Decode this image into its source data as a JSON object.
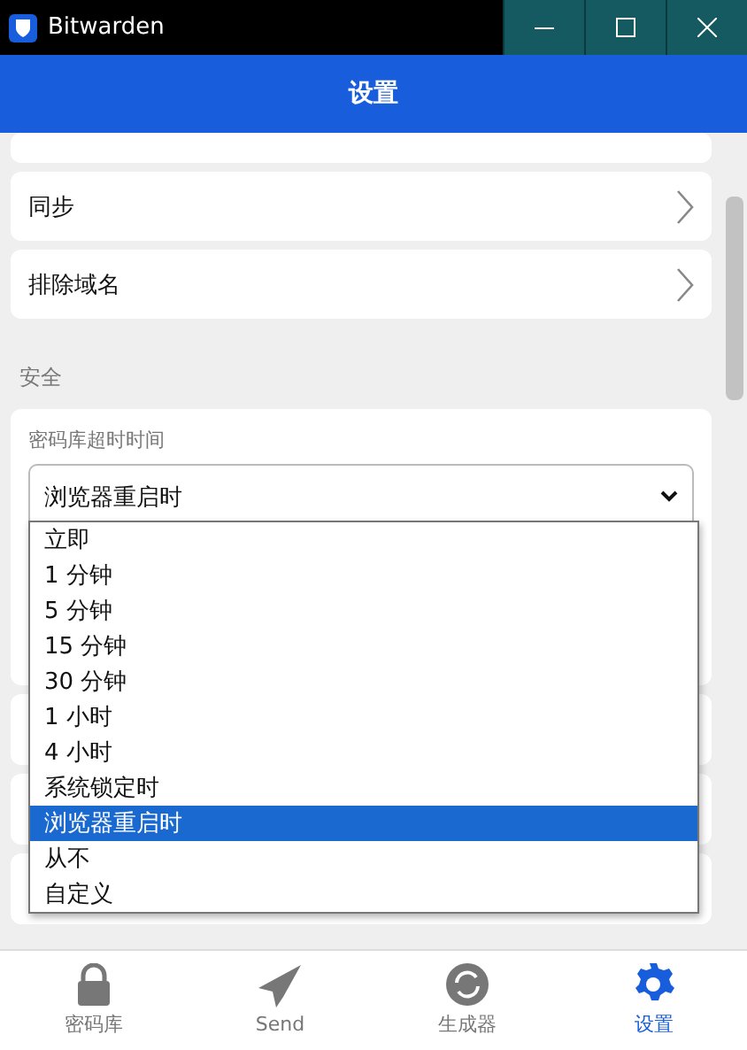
{
  "window": {
    "title": "Bitwarden",
    "controls": [
      {
        "kind": "minimize"
      },
      {
        "kind": "maximize"
      },
      {
        "kind": "close"
      }
    ]
  },
  "header": {
    "title": "设置"
  },
  "menu_items": [
    {
      "label": "同步"
    },
    {
      "label": "排除域名"
    }
  ],
  "security": {
    "heading": "安全",
    "vault_timeout": {
      "label": "密码库超时时间",
      "value": "浏览器重启时",
      "options": [
        {
          "label": "立即",
          "selected": false
        },
        {
          "label": "1 分钟",
          "selected": false
        },
        {
          "label": "5 分钟",
          "selected": false
        },
        {
          "label": "15 分钟",
          "selected": false
        },
        {
          "label": "30 分钟",
          "selected": false
        },
        {
          "label": "1 小时",
          "selected": false
        },
        {
          "label": "4 小时",
          "selected": false
        },
        {
          "label": "系统锁定时",
          "selected": false
        },
        {
          "label": "浏览器重启时",
          "selected": true
        },
        {
          "label": "从不",
          "selected": false
        },
        {
          "label": "自定义",
          "selected": false
        }
      ]
    }
  },
  "nav": [
    {
      "label": "密码库",
      "kind": "lock",
      "selected": false
    },
    {
      "label": "Send",
      "kind": "send",
      "selected": false
    },
    {
      "label": "生成器",
      "kind": "generator",
      "selected": false
    },
    {
      "label": "设置",
      "kind": "gear",
      "selected": true
    }
  ]
}
